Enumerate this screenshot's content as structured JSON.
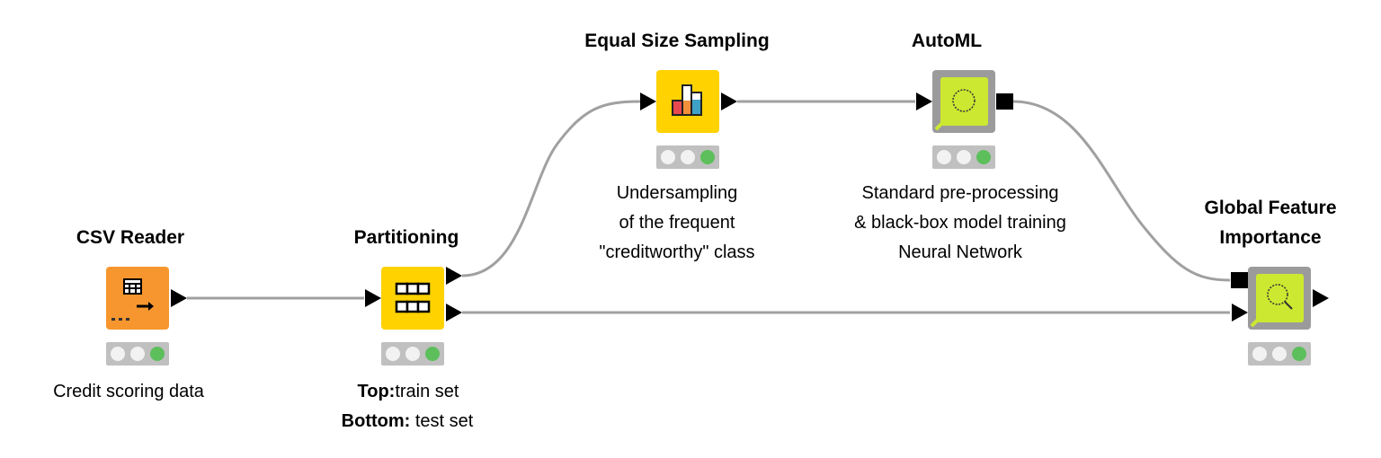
{
  "colors": {
    "reader": "#f7962e",
    "manipulator": "#ffd200",
    "learner": "#cde831",
    "frame": "#9b9b9b",
    "wire": "#a0a0a0",
    "status_ok": "#5cbf5b"
  },
  "nodes": [
    {
      "title": "CSV Reader",
      "icon": "table-read-icon",
      "labels": [
        "Credit scoring data"
      ],
      "status": "executed"
    },
    {
      "title": "Partitioning",
      "icon": "partition-icon",
      "labels_rich": [
        {
          "bold": "Top:",
          "text": "train set"
        },
        {
          "bold": "Bottom:",
          "text": " test set"
        }
      ],
      "status": "executed"
    },
    {
      "title": "Equal Size Sampling",
      "icon": "bar-chart-icon",
      "labels": [
        "Undersampling",
        "of the frequent",
        "\"creditworthy\" class"
      ],
      "status": "executed"
    },
    {
      "title": "AutoML",
      "icon": "loop-icon",
      "labels": [
        "Standard pre-processing",
        "& black-box  model  training",
        "Neural Network"
      ],
      "status": "executed"
    },
    {
      "title_lines": [
        "Global Feature",
        "Importance"
      ],
      "icon": "magnifier-icon",
      "status": "executed"
    }
  ]
}
